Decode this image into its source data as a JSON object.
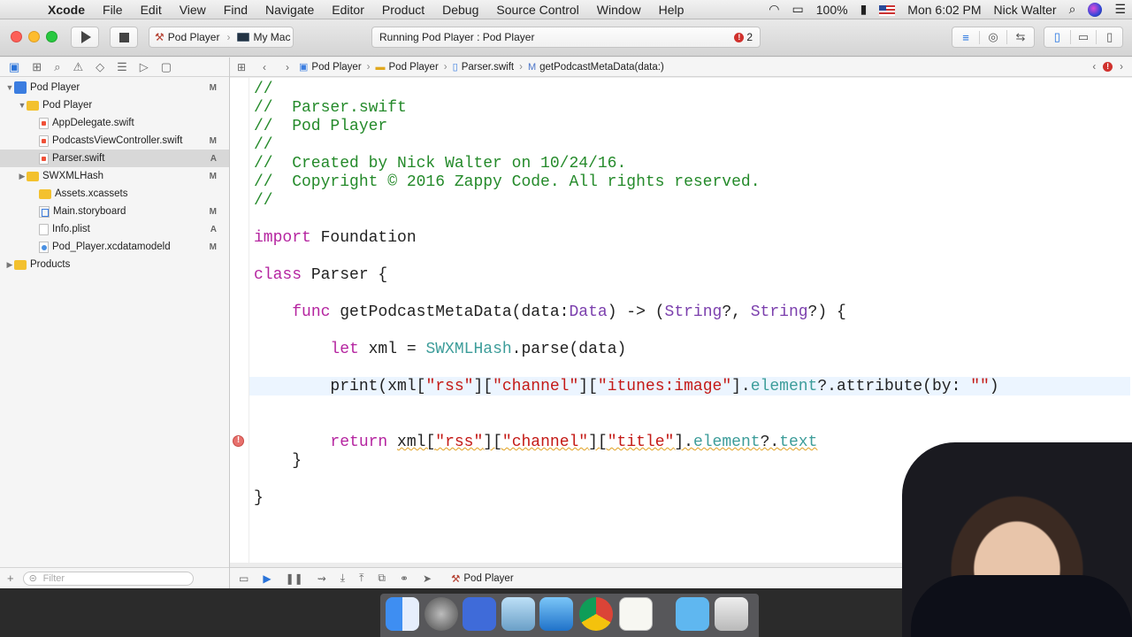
{
  "menubar": {
    "app": "Xcode",
    "items": [
      "File",
      "Edit",
      "View",
      "Find",
      "Navigate",
      "Editor",
      "Product",
      "Debug",
      "Source Control",
      "Window",
      "Help"
    ],
    "battery": "100%",
    "clock": "Mon 6:02 PM",
    "user": "Nick Walter"
  },
  "toolbar": {
    "scheme": "Pod Player",
    "destination": "My Mac",
    "status": "Running Pod Player : Pod Player",
    "error_count": "2"
  },
  "navigator": {
    "tree": [
      {
        "label": "Pod Player",
        "badge": "M",
        "type": "project",
        "indent": 0,
        "disclosure": "▼"
      },
      {
        "label": "Pod Player",
        "badge": "",
        "type": "folder",
        "indent": 1,
        "disclosure": "▼"
      },
      {
        "label": "AppDelegate.swift",
        "badge": "",
        "type": "swift",
        "indent": 2,
        "disclosure": ""
      },
      {
        "label": "PodcastsViewController.swift",
        "badge": "M",
        "type": "swift",
        "indent": 2,
        "disclosure": ""
      },
      {
        "label": "Parser.swift",
        "badge": "A",
        "type": "swift",
        "indent": 2,
        "disclosure": "",
        "selected": true
      },
      {
        "label": "SWXMLHash",
        "badge": "M",
        "type": "folder",
        "indent": 1,
        "disclosure": "▶"
      },
      {
        "label": "Assets.xcassets",
        "badge": "",
        "type": "folder",
        "indent": 2,
        "disclosure": ""
      },
      {
        "label": "Main.storyboard",
        "badge": "M",
        "type": "storyboard",
        "indent": 2,
        "disclosure": ""
      },
      {
        "label": "Info.plist",
        "badge": "A",
        "type": "file",
        "indent": 2,
        "disclosure": ""
      },
      {
        "label": "Pod_Player.xcdatamodeld",
        "badge": "M",
        "type": "model",
        "indent": 2,
        "disclosure": ""
      },
      {
        "label": "Products",
        "badge": "",
        "type": "folder",
        "indent": 0,
        "disclosure": "▶"
      }
    ],
    "filter_placeholder": "Filter"
  },
  "jumpbar": {
    "crumbs": [
      "Pod Player",
      "Pod Player",
      "Parser.swift",
      "getPodcastMetaData(data:)"
    ]
  },
  "editor": {
    "lines": [
      [
        [
          "c-com",
          "//"
        ]
      ],
      [
        [
          "c-com",
          "//  Parser.swift"
        ]
      ],
      [
        [
          "c-com",
          "//  Pod Player"
        ]
      ],
      [
        [
          "c-com",
          "//"
        ]
      ],
      [
        [
          "c-com",
          "//  Created by Nick Walter on 10/24/16."
        ]
      ],
      [
        [
          "c-com",
          "//  Copyright © 2016 Zappy Code. All rights reserved."
        ]
      ],
      [
        [
          "c-com",
          "//"
        ]
      ],
      [],
      [
        [
          "c-kw",
          "import"
        ],
        [
          "",
          " Foundation"
        ]
      ],
      [],
      [
        [
          "c-kw",
          "class"
        ],
        [
          "",
          " Parser {"
        ]
      ],
      [],
      [
        [
          "",
          "    "
        ],
        [
          "c-kw",
          "func"
        ],
        [
          "",
          " getPodcastMetaData(data:"
        ],
        [
          "c-ty",
          "Data"
        ],
        [
          "",
          ") -> ("
        ],
        [
          "c-ty",
          "String"
        ],
        [
          "",
          "?, "
        ],
        [
          "c-ty",
          "String"
        ],
        [
          "",
          "?) {"
        ]
      ],
      [],
      [
        [
          "",
          "        "
        ],
        [
          "c-kw",
          "let"
        ],
        [
          "",
          " xml = "
        ],
        [
          "c-cls",
          "SWXMLHash"
        ],
        [
          "",
          ".parse(data)"
        ]
      ],
      [],
      [
        [
          "",
          "        print(xml["
        ],
        [
          "c-str",
          "\"rss\""
        ],
        [
          "",
          "]["
        ],
        [
          "c-str",
          "\"channel\""
        ],
        [
          "",
          "]["
        ],
        [
          "c-str",
          "\"itunes:image\""
        ],
        [
          "",
          "]."
        ],
        [
          "c-prop",
          "element"
        ],
        [
          "",
          "?.attribute(by: "
        ],
        [
          "c-str",
          "\"\""
        ],
        [
          "",
          ")"
        ]
      ],
      [],
      [],
      [
        [
          "",
          "        "
        ],
        [
          "c-kw",
          "return"
        ],
        [
          "",
          " "
        ],
        [
          "squig",
          "xml["
        ],
        [
          "c-str squig",
          "\"rss\""
        ],
        [
          "squig",
          "]["
        ],
        [
          "c-str squig",
          "\"channel\""
        ],
        [
          "squig",
          "]["
        ],
        [
          "c-str squig",
          "\"title\""
        ],
        [
          "squig",
          "]."
        ],
        [
          "c-prop squig",
          "element"
        ],
        [
          "squig",
          "?."
        ],
        [
          "c-prop squig",
          "text"
        ]
      ],
      [
        [
          "",
          "    }"
        ]
      ],
      [],
      [
        [
          "",
          "}"
        ]
      ]
    ]
  },
  "debugbar": {
    "target": "Pod Player"
  }
}
